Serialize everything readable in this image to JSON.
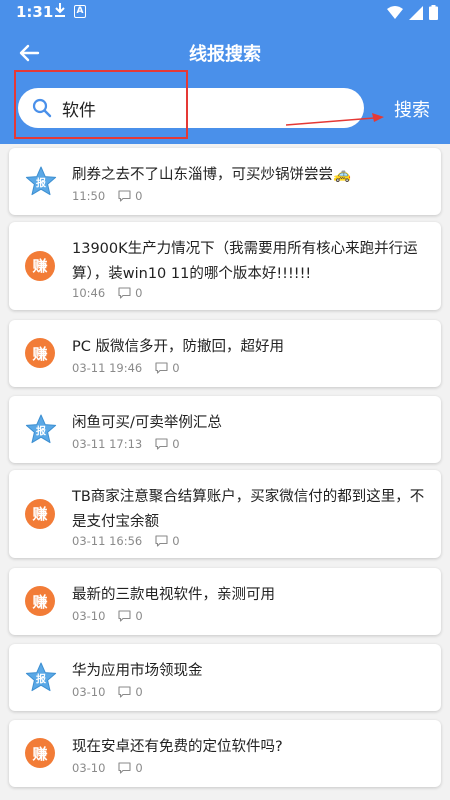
{
  "status": {
    "time": "1:31",
    "download_icon": "download-icon",
    "a_icon": "A"
  },
  "header": {
    "title": "线报搜索",
    "search_value": "软件",
    "search_button": "搜索",
    "bg_color": "#4a90ea"
  },
  "items": [
    {
      "badge": "报",
      "type": "bao",
      "title": "刷券之去不了山东淄博，可买炒锅饼尝尝🚕",
      "time": "11:50",
      "comments": "0"
    },
    {
      "badge": "赚",
      "type": "zhuan",
      "title": "13900K生产力情况下（我需要用所有核心来跑并行运算），装win10 11的哪个版本好!!!!!!",
      "time": "10:46",
      "comments": "0"
    },
    {
      "badge": "赚",
      "type": "zhuan",
      "title": "PC 版微信多开，防撤回，超好用",
      "time": "03-11 19:46",
      "comments": "0"
    },
    {
      "badge": "报",
      "type": "bao",
      "title": "闲鱼可买/可卖举例汇总",
      "time": "03-11 17:13",
      "comments": "0"
    },
    {
      "badge": "赚",
      "type": "zhuan",
      "title": "TB商家注意聚合结算账户，买家微信付的都到这里，不是支付宝余额",
      "time": "03-11 16:56",
      "comments": "0"
    },
    {
      "badge": "赚",
      "type": "zhuan",
      "title": "最新的三款电视软件，亲测可用",
      "time": "03-10",
      "comments": "0"
    },
    {
      "badge": "报",
      "type": "bao",
      "title": "华为应用市场领现金",
      "time": "03-10",
      "comments": "0"
    },
    {
      "badge": "赚",
      "type": "zhuan",
      "title": "现在安卓还有免费的定位软件吗?",
      "time": "03-10",
      "comments": "0"
    }
  ]
}
